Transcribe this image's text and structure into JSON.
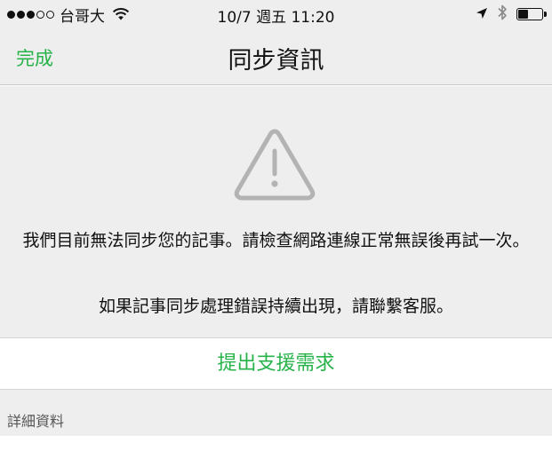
{
  "status_bar": {
    "signal_filled": 3,
    "signal_total": 5,
    "carrier": "台哥大",
    "time": "10/7 週五 11:20",
    "battery_level": 0.45,
    "icons": [
      "wifi-icon",
      "location-arrow-icon",
      "bluetooth-icon",
      "battery-icon"
    ]
  },
  "nav": {
    "done_label": "完成",
    "title": "同步資訊"
  },
  "content": {
    "icon": "warning-triangle-icon",
    "message_1": "我們目前無法同步您的記事。請檢查網路連線正常無誤後再試一次。",
    "message_2": "如果記事同步處理錯誤持續出現，請聯繫客服。",
    "support_button": "提出支援需求",
    "details_label": "詳細資料"
  },
  "colors": {
    "accent": "#27b34a",
    "background": "#eeeeee",
    "icon_gray": "#b3b3b3"
  }
}
